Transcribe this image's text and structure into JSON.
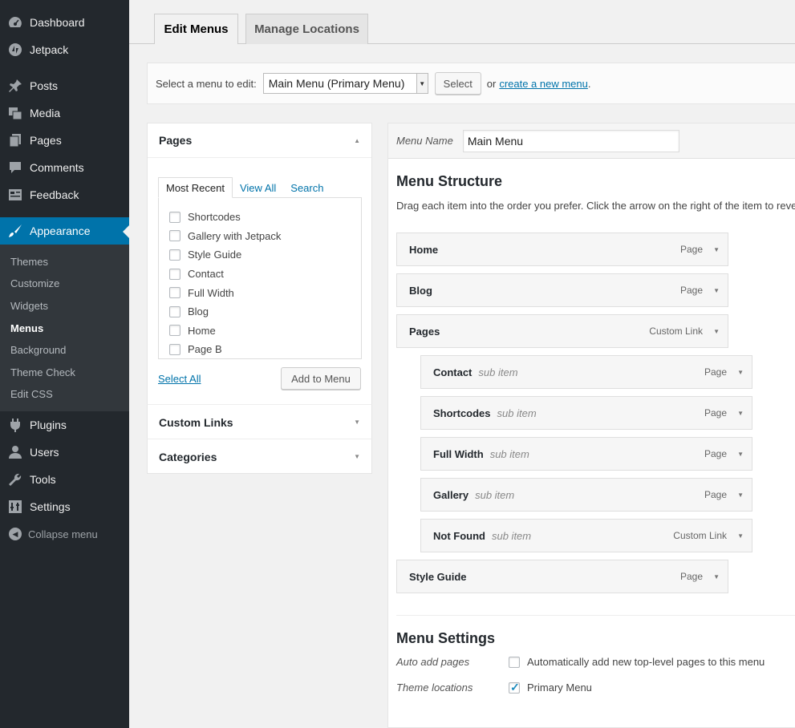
{
  "sidebar": {
    "items": [
      {
        "label": "Dashboard",
        "icon": "dashboard-icon"
      },
      {
        "label": "Jetpack",
        "icon": "jetpack-icon"
      },
      {
        "label": "Posts",
        "icon": "pin-icon"
      },
      {
        "label": "Media",
        "icon": "media-icon"
      },
      {
        "label": "Pages",
        "icon": "pages-icon"
      },
      {
        "label": "Comments",
        "icon": "comment-icon"
      },
      {
        "label": "Feedback",
        "icon": "feedback-icon"
      },
      {
        "label": "Appearance",
        "icon": "paintbrush-icon"
      },
      {
        "label": "Plugins",
        "icon": "plugin-icon"
      },
      {
        "label": "Users",
        "icon": "user-icon"
      },
      {
        "label": "Tools",
        "icon": "wrench-icon"
      },
      {
        "label": "Settings",
        "icon": "settings-icon"
      }
    ],
    "submenu": [
      "Themes",
      "Customize",
      "Widgets",
      "Menus",
      "Background",
      "Theme Check",
      "Edit CSS"
    ],
    "collapse": "Collapse menu"
  },
  "tabs": {
    "edit": "Edit Menus",
    "manage": "Manage Locations"
  },
  "select_bar": {
    "label": "Select a menu to edit:",
    "selected": "Main Menu (Primary Menu)",
    "button": "Select",
    "or_text": "or",
    "link": "create a new menu",
    "period": "."
  },
  "pages_box": {
    "title": "Pages",
    "tabs": [
      "Most Recent",
      "View All",
      "Search"
    ],
    "items": [
      "Shortcodes",
      "Gallery with Jetpack",
      "Style Guide",
      "Contact",
      "Full Width",
      "Blog",
      "Home",
      "Page B"
    ],
    "select_all": "Select All",
    "add_button": "Add to Menu"
  },
  "custom_links": {
    "title": "Custom Links"
  },
  "categories": {
    "title": "Categories"
  },
  "menu": {
    "name_label": "Menu Name",
    "name_value": "Main Menu",
    "structure_title": "Menu Structure",
    "structure_desc": "Drag each item into the order you prefer. Click the arrow on the right of the item to reveal additional configuration options.",
    "items": [
      {
        "title": "Home",
        "sub": "",
        "kind": "Page"
      },
      {
        "title": "Blog",
        "sub": "",
        "kind": "Page"
      },
      {
        "title": "Pages",
        "sub": "",
        "kind": "Custom Link"
      },
      {
        "title": "Contact",
        "sub": "sub item",
        "kind": "Page"
      },
      {
        "title": "Shortcodes",
        "sub": "sub item",
        "kind": "Page"
      },
      {
        "title": "Full Width",
        "sub": "sub item",
        "kind": "Page"
      },
      {
        "title": "Gallery",
        "sub": "sub item",
        "kind": "Page"
      },
      {
        "title": "Not Found",
        "sub": "sub item",
        "kind": "Custom Link"
      },
      {
        "title": "Style Guide",
        "sub": "",
        "kind": "Page"
      }
    ],
    "settings_title": "Menu Settings",
    "auto_add_label": "Auto add pages",
    "auto_add_text": "Automatically add new top-level pages to this menu",
    "locations_label": "Theme locations",
    "primary_text": "Primary Menu"
  }
}
